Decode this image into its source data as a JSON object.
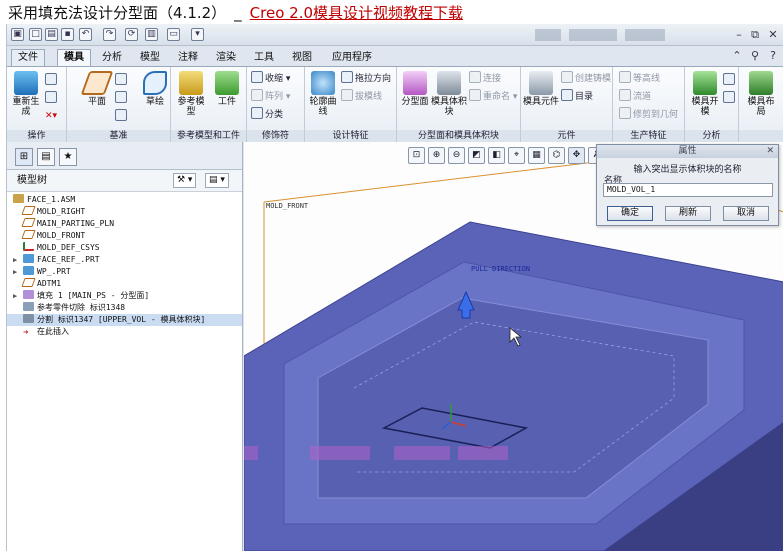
{
  "header": {
    "title": "采用填充法设计分型面（4.1.2）",
    "separator": "_",
    "link_text": "Creo 2.0模具设计视频教程下载"
  },
  "menu_tabs": [
    "文件",
    "模具",
    "分析",
    "模型",
    "注释",
    "渲染",
    "工具",
    "视图",
    "应用程序"
  ],
  "ribbon": {
    "groups": [
      {
        "label": "操作",
        "buttons": [
          "重新生成"
        ]
      },
      {
        "label": "基准",
        "buttons": [
          "平面",
          "草绘"
        ]
      },
      {
        "label": "参考模型和工件",
        "buttons": [
          "参考模型",
          "工件"
        ]
      },
      {
        "label": "修饰符",
        "small": [
          "收缩",
          "阵列",
          "分类"
        ]
      },
      {
        "label": "设计特征",
        "buttons": [
          "轮廓曲线"
        ],
        "small": [
          "拖拉方向",
          "拔模线"
        ]
      },
      {
        "label": "分型面和模具体积块",
        "buttons": [
          "分型面",
          "模具体积块"
        ],
        "small": [
          "连接",
          "重命名"
        ]
      },
      {
        "label": "元件",
        "buttons": [
          "模具元件"
        ],
        "small": [
          "创建铸模",
          "目录"
        ]
      },
      {
        "label": "生产特征",
        "small": [
          "等高线",
          "流道",
          "修剪到几何"
        ]
      },
      {
        "label": "分析",
        "buttons": [
          "模具开模"
        ]
      },
      {
        "label": "",
        "buttons": [
          "模具布局"
        ]
      }
    ]
  },
  "sidebar": {
    "tree_title": "模型树",
    "items": [
      {
        "label": "FACE_1.ASM",
        "icon": "assembly-icon"
      },
      {
        "label": "MOLD_RIGHT",
        "icon": "datum-plane-icon"
      },
      {
        "label": "MAIN_PARTING_PLN",
        "icon": "datum-plane-icon"
      },
      {
        "label": "MOLD_FRONT",
        "icon": "datum-plane-icon"
      },
      {
        "label": "MOLD_DEF_CSYS",
        "icon": "csys-icon"
      },
      {
        "label": "FACE_REF_.PRT",
        "icon": "part-icon"
      },
      {
        "label": "WP_.PRT",
        "icon": "part-icon"
      },
      {
        "label": "ADTM1",
        "icon": "datum-plane-icon"
      },
      {
        "label": "填充 1 [MAIN_PS - 分型面]",
        "icon": "surface-icon"
      },
      {
        "label": "参考零件切除 标识1348",
        "icon": "cut-icon"
      },
      {
        "label": "分割 标识1347 [UPPER_VOL - 模具体积块]",
        "icon": "split-icon"
      },
      {
        "label": "在此插入",
        "icon": "insert-arrow-icon"
      }
    ]
  },
  "viewport": {
    "label_front": "MOLD_FRONT",
    "label_pull": "PULL DIRECTION"
  },
  "dialog": {
    "title": "属性",
    "prompt": "输入突出显示体积块的名称",
    "field_label": "名称",
    "field_value": "MOLD_VOL_1",
    "ok": "确定",
    "refresh": "刷新",
    "cancel": "取消"
  }
}
